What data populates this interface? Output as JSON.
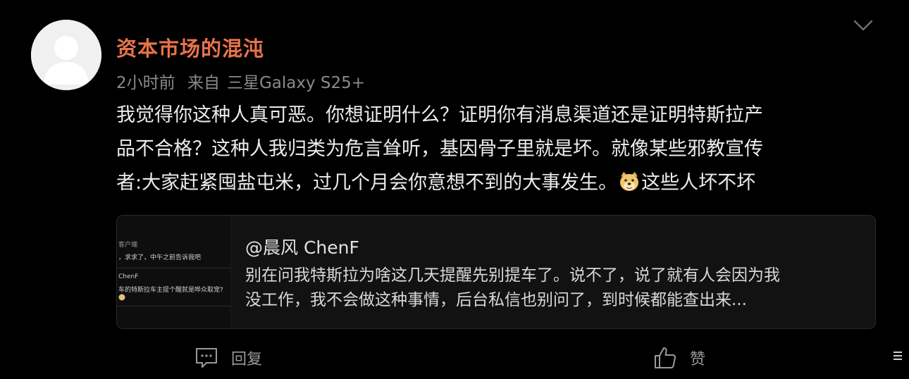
{
  "post": {
    "username": "资本市场的混沌",
    "time_ago": "2小时前",
    "source_prefix": "来自",
    "device": "三星Galaxy S25+",
    "content_lines": [
      "我觉得你这种人真可恶。你想证明什么？证明你有消息渠道还是证明特斯拉产",
      "品不合格？这种人我归类为危言耸听，基因骨子里就是坏。就像某些邪教宣传",
      "者:大家赶紧囤盐屯米，过几个月会你意想不到的大事发生。",
      "这些人坏不坏"
    ],
    "emoji": "doge-emoji"
  },
  "quote": {
    "author": "@晨风 ChenF",
    "text_lines": [
      "别在问我特斯拉为啥这几天提醒先别提车了。说不了，说了就有人会因为我",
      "没工作，我不会做这种事情，后台私信也别问了，到时候都能查出来..."
    ],
    "thumbnail_lines": [
      "客户端",
      "，求求了，中午之前告诉我吧",
      "ChenF",
      "车的特斯拉车主提个醒就是哗众取宠?"
    ]
  },
  "actions": {
    "reply_label": "回复",
    "like_label": "赞"
  },
  "colors": {
    "background": "#000000",
    "username": "#e8734a",
    "meta": "#8a8a8a",
    "text": "#ececec"
  },
  "icons": {
    "menu": "chevron-down-icon",
    "reply": "comment-icon",
    "like": "thumbs-up-icon"
  }
}
